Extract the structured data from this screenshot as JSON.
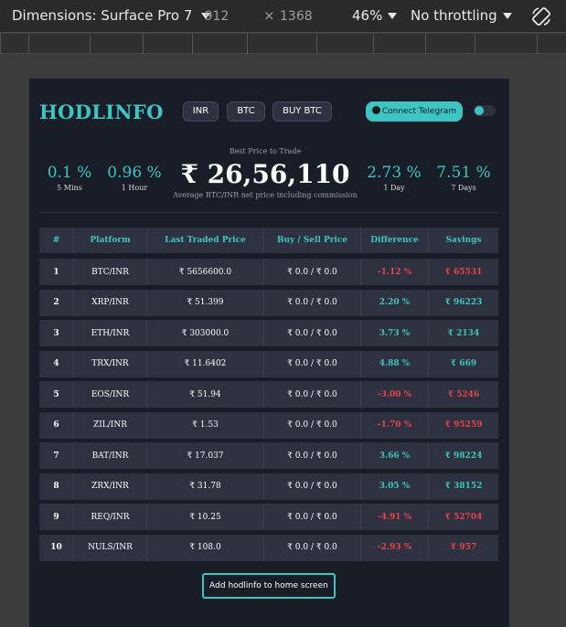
{
  "devtools": {
    "dimensions_label": "Dimensions: Surface Pro 7",
    "width": "912",
    "times": "×",
    "height": "1368",
    "zoom": "46%",
    "throttling": "No throttling",
    "rotate_icon": "rotate-icon"
  },
  "header": {
    "logo": "HODLINFO",
    "currency_label": "INR",
    "coin_label": "BTC",
    "buy_label": "BUY BTC",
    "telegram_label": "Connect Telegram"
  },
  "stats": {
    "left": [
      {
        "value": "0.1 %",
        "label": "5 Mins"
      },
      {
        "value": "0.96 %",
        "label": "1 Hour"
      }
    ],
    "right": [
      {
        "value": "2.73 %",
        "label": "1 Day"
      },
      {
        "value": "7.51 %",
        "label": "7 Days"
      }
    ],
    "best_price_label": "Best Price to Trade",
    "best_price": "₹ 26,56,110",
    "best_price_note": "Average BTC/INR net price including commission"
  },
  "table": {
    "headers": [
      "#",
      "Platform",
      "Last Traded Price",
      "Buy / Sell Price",
      "Difference",
      "Savings"
    ],
    "rows": [
      {
        "idx": "1",
        "platform": "BTC/INR",
        "last": "₹ 5656600.0",
        "buysell": "₹ 0.0 / ₹ 0.0",
        "diff": "-1.12 %",
        "savings": "₹ 65531",
        "positive": false
      },
      {
        "idx": "2",
        "platform": "XRP/INR",
        "last": "₹ 51.399",
        "buysell": "₹ 0.0 / ₹ 0.0",
        "diff": "2.20 %",
        "savings": "₹ 96223",
        "positive": true
      },
      {
        "idx": "3",
        "platform": "ETH/INR",
        "last": "₹ 303000.0",
        "buysell": "₹ 0.0 / ₹ 0.0",
        "diff": "3.73 %",
        "savings": "₹ 2134",
        "positive": true
      },
      {
        "idx": "4",
        "platform": "TRX/INR",
        "last": "₹ 11.6402",
        "buysell": "₹ 0.0 / ₹ 0.0",
        "diff": "4.88 %",
        "savings": "₹ 669",
        "positive": true
      },
      {
        "idx": "5",
        "platform": "EOS/INR",
        "last": "₹ 51.94",
        "buysell": "₹ 0.0 / ₹ 0.0",
        "diff": "-3.00 %",
        "savings": "₹ 5246",
        "positive": false
      },
      {
        "idx": "6",
        "platform": "ZIL/INR",
        "last": "₹ 1.53",
        "buysell": "₹ 0.0 / ₹ 0.0",
        "diff": "-1.70 %",
        "savings": "₹ 95259",
        "positive": false
      },
      {
        "idx": "7",
        "platform": "BAT/INR",
        "last": "₹ 17.037",
        "buysell": "₹ 0.0 / ₹ 0.0",
        "diff": "3.66 %",
        "savings": "₹ 98224",
        "positive": true
      },
      {
        "idx": "8",
        "platform": "ZRX/INR",
        "last": "₹ 31.78",
        "buysell": "₹ 0.0 / ₹ 0.0",
        "diff": "3.05 %",
        "savings": "₹ 38152",
        "positive": true
      },
      {
        "idx": "9",
        "platform": "REQ/INR",
        "last": "₹ 10.25",
        "buysell": "₹ 0.0 / ₹ 0.0",
        "diff": "-4.91 %",
        "savings": "₹ 52704",
        "positive": false
      },
      {
        "idx": "10",
        "platform": "NULS/INR",
        "last": "₹ 108.0",
        "buysell": "₹ 0.0 / ₹ 0.0",
        "diff": "-2.93 %",
        "savings": "₹ 957",
        "positive": false
      }
    ]
  },
  "footer": {
    "add_home_label": "Add hodlinfo to home screen"
  },
  "colors": {
    "accent": "#3dc6c1",
    "negative": "#e8434a",
    "page_bg": "#191d28",
    "row_bg": "#2e3240"
  }
}
